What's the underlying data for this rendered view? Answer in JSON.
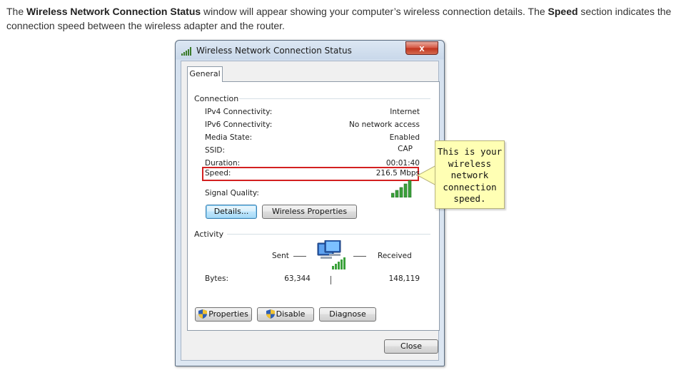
{
  "intro": {
    "part1": "The ",
    "bold1": "Wireless Network Connection Status",
    "part2": " window will appear showing your computer’s wireless connection details.  The ",
    "bold2": "Speed",
    "part3": " section indicates the connection speed between the wireless adapter and the router."
  },
  "window": {
    "title": "Wireless Network Connection Status",
    "title_icon": "signal-bars-icon",
    "close_glyph": "x",
    "tab": "General"
  },
  "connection": {
    "label": "Connection",
    "rows": [
      {
        "label": "IPv4 Connectivity:",
        "value": "Internet"
      },
      {
        "label": "IPv6 Connectivity:",
        "value": "No network access"
      },
      {
        "label": "Media State:",
        "value": "Enabled"
      },
      {
        "label": "SSID:",
        "value": "CAP"
      },
      {
        "label": "Duration:",
        "value": "00:01:40"
      },
      {
        "label": "Speed:",
        "value": "216.5 Mbps"
      }
    ],
    "signal_quality_label": "Signal Quality:",
    "signal_icon": "signal-strength-icon",
    "details_button": "Details...",
    "wireless_properties_button": "Wireless Properties"
  },
  "activity": {
    "label": "Activity",
    "sent_label": "Sent",
    "received_label": "Received",
    "computers_icon": "network-computers-icon",
    "bytes_label": "Bytes:",
    "bytes_sent": "63,344",
    "bytes_received": "148,119"
  },
  "bottom_buttons": {
    "properties": "Properties",
    "disable": "Disable",
    "diagnose": "Diagnose",
    "shield_icon": "uac-shield-icon"
  },
  "close_button": "Close",
  "callout": {
    "lines": [
      "This is your",
      "wireless",
      "network",
      "connection",
      "speed."
    ]
  },
  "colors": {
    "highlight_border": "#d32020",
    "callout_fill": "#ffffb4",
    "signal_green": "#3aa13a"
  }
}
